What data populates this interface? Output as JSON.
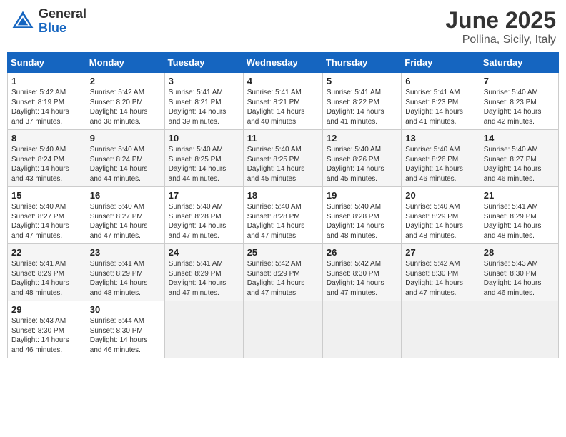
{
  "header": {
    "logo_general": "General",
    "logo_blue": "Blue",
    "month_year": "June 2025",
    "location": "Pollina, Sicily, Italy"
  },
  "calendar": {
    "days_of_week": [
      "Sunday",
      "Monday",
      "Tuesday",
      "Wednesday",
      "Thursday",
      "Friday",
      "Saturday"
    ],
    "weeks": [
      [
        {
          "day": "",
          "detail": ""
        },
        {
          "day": "2",
          "detail": "Sunrise: 5:42 AM\nSunset: 8:20 PM\nDaylight: 14 hours\nand 38 minutes."
        },
        {
          "day": "3",
          "detail": "Sunrise: 5:41 AM\nSunset: 8:21 PM\nDaylight: 14 hours\nand 39 minutes."
        },
        {
          "day": "4",
          "detail": "Sunrise: 5:41 AM\nSunset: 8:21 PM\nDaylight: 14 hours\nand 40 minutes."
        },
        {
          "day": "5",
          "detail": "Sunrise: 5:41 AM\nSunset: 8:22 PM\nDaylight: 14 hours\nand 41 minutes."
        },
        {
          "day": "6",
          "detail": "Sunrise: 5:41 AM\nSunset: 8:23 PM\nDaylight: 14 hours\nand 41 minutes."
        },
        {
          "day": "7",
          "detail": "Sunrise: 5:40 AM\nSunset: 8:23 PM\nDaylight: 14 hours\nand 42 minutes."
        }
      ],
      [
        {
          "day": "1",
          "detail": "Sunrise: 5:42 AM\nSunset: 8:19 PM\nDaylight: 14 hours\nand 37 minutes."
        },
        {
          "day": "",
          "detail": ""
        },
        {
          "day": "",
          "detail": ""
        },
        {
          "day": "",
          "detail": ""
        },
        {
          "day": "",
          "detail": ""
        },
        {
          "day": "",
          "detail": ""
        },
        {
          "day": "",
          "detail": ""
        }
      ],
      [
        {
          "day": "8",
          "detail": "Sunrise: 5:40 AM\nSunset: 8:24 PM\nDaylight: 14 hours\nand 43 minutes."
        },
        {
          "day": "9",
          "detail": "Sunrise: 5:40 AM\nSunset: 8:24 PM\nDaylight: 14 hours\nand 44 minutes."
        },
        {
          "day": "10",
          "detail": "Sunrise: 5:40 AM\nSunset: 8:25 PM\nDaylight: 14 hours\nand 44 minutes."
        },
        {
          "day": "11",
          "detail": "Sunrise: 5:40 AM\nSunset: 8:25 PM\nDaylight: 14 hours\nand 45 minutes."
        },
        {
          "day": "12",
          "detail": "Sunrise: 5:40 AM\nSunset: 8:26 PM\nDaylight: 14 hours\nand 45 minutes."
        },
        {
          "day": "13",
          "detail": "Sunrise: 5:40 AM\nSunset: 8:26 PM\nDaylight: 14 hours\nand 46 minutes."
        },
        {
          "day": "14",
          "detail": "Sunrise: 5:40 AM\nSunset: 8:27 PM\nDaylight: 14 hours\nand 46 minutes."
        }
      ],
      [
        {
          "day": "15",
          "detail": "Sunrise: 5:40 AM\nSunset: 8:27 PM\nDaylight: 14 hours\nand 47 minutes."
        },
        {
          "day": "16",
          "detail": "Sunrise: 5:40 AM\nSunset: 8:27 PM\nDaylight: 14 hours\nand 47 minutes."
        },
        {
          "day": "17",
          "detail": "Sunrise: 5:40 AM\nSunset: 8:28 PM\nDaylight: 14 hours\nand 47 minutes."
        },
        {
          "day": "18",
          "detail": "Sunrise: 5:40 AM\nSunset: 8:28 PM\nDaylight: 14 hours\nand 47 minutes."
        },
        {
          "day": "19",
          "detail": "Sunrise: 5:40 AM\nSunset: 8:28 PM\nDaylight: 14 hours\nand 48 minutes."
        },
        {
          "day": "20",
          "detail": "Sunrise: 5:40 AM\nSunset: 8:29 PM\nDaylight: 14 hours\nand 48 minutes."
        },
        {
          "day": "21",
          "detail": "Sunrise: 5:41 AM\nSunset: 8:29 PM\nDaylight: 14 hours\nand 48 minutes."
        }
      ],
      [
        {
          "day": "22",
          "detail": "Sunrise: 5:41 AM\nSunset: 8:29 PM\nDaylight: 14 hours\nand 48 minutes."
        },
        {
          "day": "23",
          "detail": "Sunrise: 5:41 AM\nSunset: 8:29 PM\nDaylight: 14 hours\nand 48 minutes."
        },
        {
          "day": "24",
          "detail": "Sunrise: 5:41 AM\nSunset: 8:29 PM\nDaylight: 14 hours\nand 47 minutes."
        },
        {
          "day": "25",
          "detail": "Sunrise: 5:42 AM\nSunset: 8:29 PM\nDaylight: 14 hours\nand 47 minutes."
        },
        {
          "day": "26",
          "detail": "Sunrise: 5:42 AM\nSunset: 8:30 PM\nDaylight: 14 hours\nand 47 minutes."
        },
        {
          "day": "27",
          "detail": "Sunrise: 5:42 AM\nSunset: 8:30 PM\nDaylight: 14 hours\nand 47 minutes."
        },
        {
          "day": "28",
          "detail": "Sunrise: 5:43 AM\nSunset: 8:30 PM\nDaylight: 14 hours\nand 46 minutes."
        }
      ],
      [
        {
          "day": "29",
          "detail": "Sunrise: 5:43 AM\nSunset: 8:30 PM\nDaylight: 14 hours\nand 46 minutes."
        },
        {
          "day": "30",
          "detail": "Sunrise: 5:44 AM\nSunset: 8:30 PM\nDaylight: 14 hours\nand 46 minutes."
        },
        {
          "day": "",
          "detail": ""
        },
        {
          "day": "",
          "detail": ""
        },
        {
          "day": "",
          "detail": ""
        },
        {
          "day": "",
          "detail": ""
        },
        {
          "day": "",
          "detail": ""
        }
      ]
    ]
  }
}
